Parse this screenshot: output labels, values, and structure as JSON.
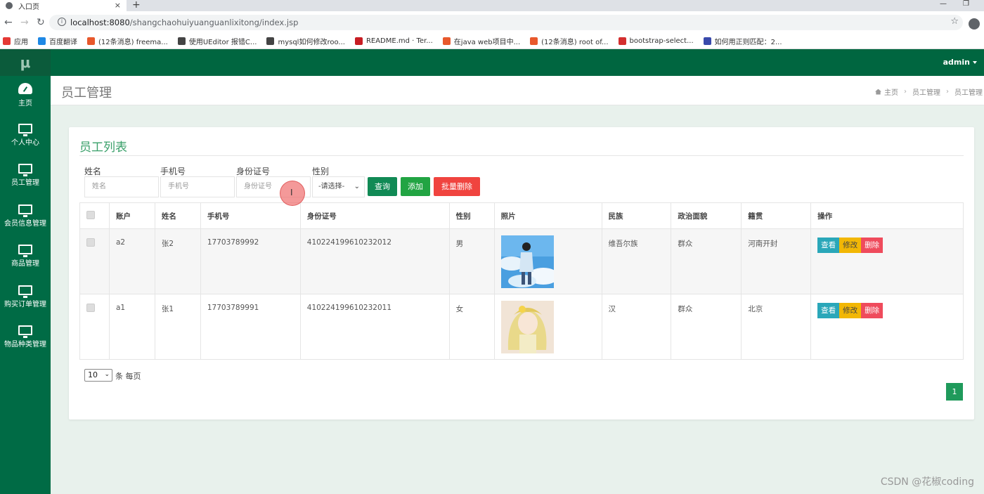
{
  "browser": {
    "tab_title": "入口页",
    "url_host": "localhost:8080",
    "url_path": "/shangchaohuiyuanguanlixitong/index.jsp",
    "bookmarks": [
      {
        "label": "应用",
        "color": "#e53935"
      },
      {
        "label": "百度翻译",
        "color": "#1e88e5"
      },
      {
        "label": "(12条消息) freema...",
        "color": "#e8582c"
      },
      {
        "label": "使用UEditor 报错C...",
        "color": "#444444"
      },
      {
        "label": "mysql如何修改roo...",
        "color": "#444444"
      },
      {
        "label": "README.md · Ter...",
        "color": "#c71d23"
      },
      {
        "label": "在java web项目中...",
        "color": "#e8582c"
      },
      {
        "label": "(12条消息) root of...",
        "color": "#e8582c"
      },
      {
        "label": "bootstrap-select...",
        "color": "#d32f2f"
      },
      {
        "label": "如何用正则匹配：2...",
        "color": "#3949ab"
      }
    ]
  },
  "app": {
    "logo": "μ",
    "user": "admin",
    "sidebar": [
      {
        "label": "主页",
        "icon": "dashboard-icon"
      },
      {
        "label": "个人中心",
        "icon": "monitor-icon"
      },
      {
        "label": "员工管理",
        "icon": "monitor-icon"
      },
      {
        "label": "会员信息管理",
        "icon": "monitor-icon"
      },
      {
        "label": "商品管理",
        "icon": "monitor-icon"
      },
      {
        "label": "购买订单管理",
        "icon": "monitor-icon"
      },
      {
        "label": "物品种类管理",
        "icon": "monitor-icon"
      }
    ],
    "page_title": "员工管理",
    "breadcrumb": [
      "主页",
      "员工管理",
      "员工管理"
    ]
  },
  "list": {
    "title": "员工列表",
    "search": {
      "name_label": "姓名",
      "name_placeholder": "姓名",
      "phone_label": "手机号",
      "phone_placeholder": "手机号",
      "idcard_label": "身份证号",
      "idcard_placeholder": "身份证号",
      "gender_label": "性别",
      "gender_selected": "-请选择-",
      "query_btn": "查询",
      "add_btn": "添加",
      "batch_delete_btn": "批量删除"
    },
    "columns": [
      "账户",
      "姓名",
      "手机号",
      "身份证号",
      "性别",
      "照片",
      "民族",
      "政治面貌",
      "籍贯",
      "操作"
    ],
    "rows": [
      {
        "account": "a2",
        "name": "张2",
        "phone": "17703789992",
        "idcard": "410224199610232012",
        "gender": "男",
        "photo": "boy-sky",
        "ethnic": "维吾尔族",
        "political": "群众",
        "origin": "河南开封"
      },
      {
        "account": "a1",
        "name": "张1",
        "phone": "17703789991",
        "idcard": "410224199610232011",
        "gender": "女",
        "photo": "girl-blonde",
        "ethnic": "汉",
        "political": "群众",
        "origin": "北京"
      }
    ],
    "actions": {
      "view": "查看",
      "edit": "修改",
      "delete": "删除"
    },
    "page_size": "10",
    "page_size_suffix": "条 每页",
    "current_page": "1"
  },
  "watermark": "CSDN @花椒coding",
  "colors": {
    "topbar": "#006640",
    "sidebar": "#006b45",
    "accent_green": "#3aa06a",
    "danger": "#ef4b5c",
    "info": "#2aa7b9",
    "warning": "#f2b705"
  }
}
